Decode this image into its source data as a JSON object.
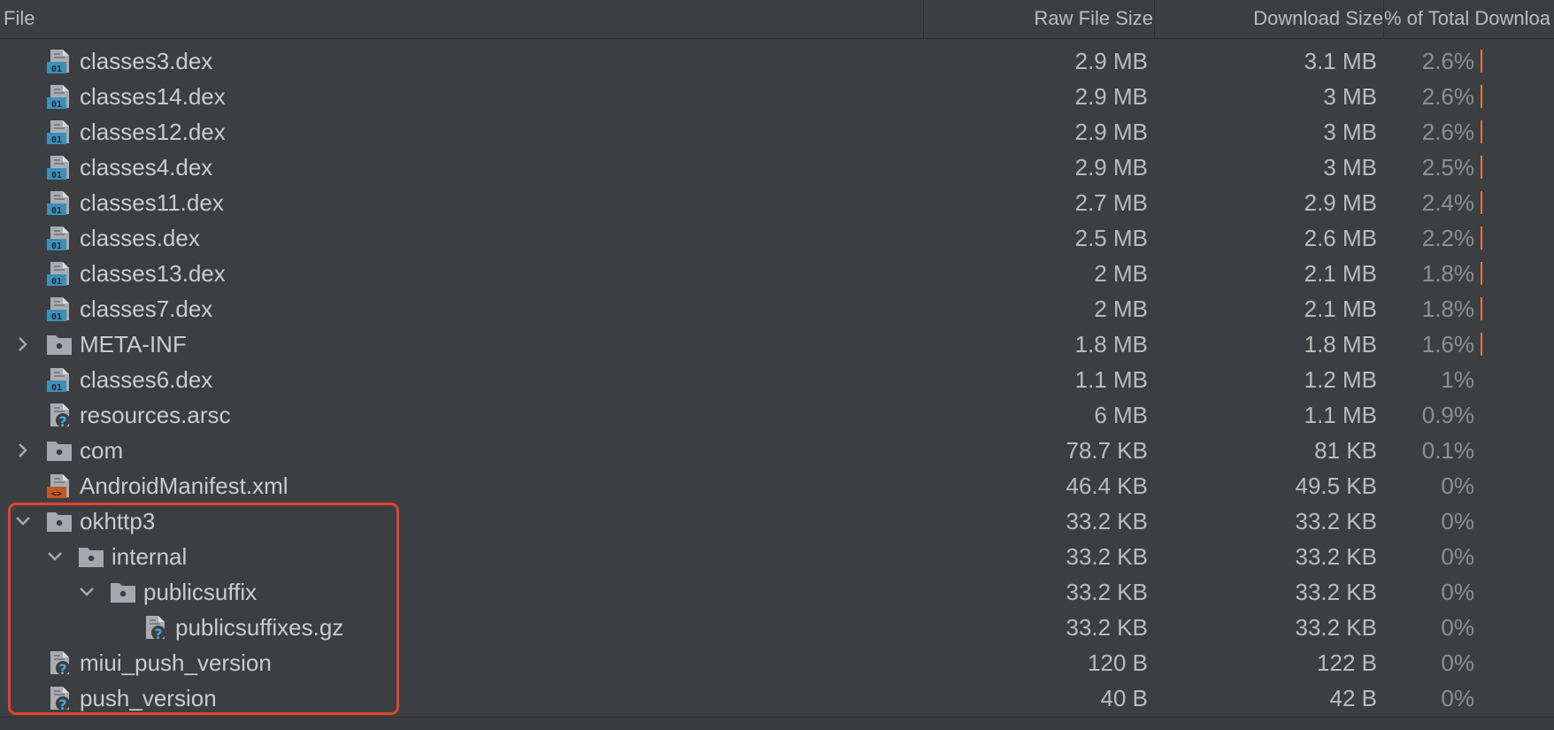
{
  "columns": {
    "file": "File",
    "raw": "Raw File Size",
    "download": "Download Size",
    "percent": "% of Total Downloa"
  },
  "rows": [
    {
      "name": "classes3.dex",
      "raw": "2.9 MB",
      "download": "3.1 MB",
      "percent": "2.6%",
      "icon": "dex-file-icon",
      "depth": 0,
      "toggle": "none",
      "share": 0.026
    },
    {
      "name": "classes14.dex",
      "raw": "2.9 MB",
      "download": "3 MB",
      "percent": "2.6%",
      "icon": "dex-file-icon",
      "depth": 0,
      "toggle": "none",
      "share": 0.026
    },
    {
      "name": "classes12.dex",
      "raw": "2.9 MB",
      "download": "3 MB",
      "percent": "2.6%",
      "icon": "dex-file-icon",
      "depth": 0,
      "toggle": "none",
      "share": 0.026
    },
    {
      "name": "classes4.dex",
      "raw": "2.9 MB",
      "download": "3 MB",
      "percent": "2.5%",
      "icon": "dex-file-icon",
      "depth": 0,
      "toggle": "none",
      "share": 0.025
    },
    {
      "name": "classes11.dex",
      "raw": "2.7 MB",
      "download": "2.9 MB",
      "percent": "2.4%",
      "icon": "dex-file-icon",
      "depth": 0,
      "toggle": "none",
      "share": 0.024
    },
    {
      "name": "classes.dex",
      "raw": "2.5 MB",
      "download": "2.6 MB",
      "percent": "2.2%",
      "icon": "dex-file-icon",
      "depth": 0,
      "toggle": "none",
      "share": 0.022
    },
    {
      "name": "classes13.dex",
      "raw": "2 MB",
      "download": "2.1 MB",
      "percent": "1.8%",
      "icon": "dex-file-icon",
      "depth": 0,
      "toggle": "none",
      "share": 0.018
    },
    {
      "name": "classes7.dex",
      "raw": "2 MB",
      "download": "2.1 MB",
      "percent": "1.8%",
      "icon": "dex-file-icon",
      "depth": 0,
      "toggle": "none",
      "share": 0.018
    },
    {
      "name": "META-INF",
      "raw": "1.8 MB",
      "download": "1.8 MB",
      "percent": "1.6%",
      "icon": "folder-icon",
      "depth": 0,
      "toggle": "collapsed",
      "share": 0.016
    },
    {
      "name": "classes6.dex",
      "raw": "1.1 MB",
      "download": "1.2 MB",
      "percent": "1%",
      "icon": "dex-file-icon",
      "depth": 0,
      "toggle": "none",
      "share": 0.01
    },
    {
      "name": "resources.arsc",
      "raw": "6 MB",
      "download": "1.1 MB",
      "percent": "0.9%",
      "icon": "unknown-file-icon",
      "depth": 0,
      "toggle": "none",
      "share": 0.009
    },
    {
      "name": "com",
      "raw": "78.7 KB",
      "download": "81 KB",
      "percent": "0.1%",
      "icon": "folder-icon",
      "depth": 0,
      "toggle": "collapsed",
      "share": 0.001
    },
    {
      "name": "AndroidManifest.xml",
      "raw": "46.4 KB",
      "download": "49.5 KB",
      "percent": "0%",
      "icon": "xml-file-icon",
      "depth": 0,
      "toggle": "none",
      "share": 0
    },
    {
      "name": "okhttp3",
      "raw": "33.2 KB",
      "download": "33.2 KB",
      "percent": "0%",
      "icon": "folder-icon",
      "depth": 0,
      "toggle": "expanded",
      "share": 0
    },
    {
      "name": "internal",
      "raw": "33.2 KB",
      "download": "33.2 KB",
      "percent": "0%",
      "icon": "folder-icon",
      "depth": 1,
      "toggle": "expanded",
      "share": 0
    },
    {
      "name": "publicsuffix",
      "raw": "33.2 KB",
      "download": "33.2 KB",
      "percent": "0%",
      "icon": "folder-icon",
      "depth": 2,
      "toggle": "expanded",
      "share": 0
    },
    {
      "name": "publicsuffixes.gz",
      "raw": "33.2 KB",
      "download": "33.2 KB",
      "percent": "0%",
      "icon": "unknown-file-icon",
      "depth": 3,
      "toggle": "none",
      "share": 0
    },
    {
      "name": "miui_push_version",
      "raw": "120 B",
      "download": "122 B",
      "percent": "0%",
      "icon": "unknown-file-icon",
      "depth": 0,
      "toggle": "none",
      "share": 0
    },
    {
      "name": "push_version",
      "raw": "40 B",
      "download": "42 B",
      "percent": "0%",
      "icon": "unknown-file-icon",
      "depth": 0,
      "toggle": "none",
      "share": 0
    }
  ],
  "colors": {
    "background": "#3c3f41",
    "text": "#bbbbbb",
    "percent_text": "#8d8f91",
    "bar": "#e8743b",
    "highlight": "#e5432f",
    "dex_badge": "#3d8fb8",
    "xml_badge": "#c05a22",
    "question_mark": "#4aa3e0"
  }
}
